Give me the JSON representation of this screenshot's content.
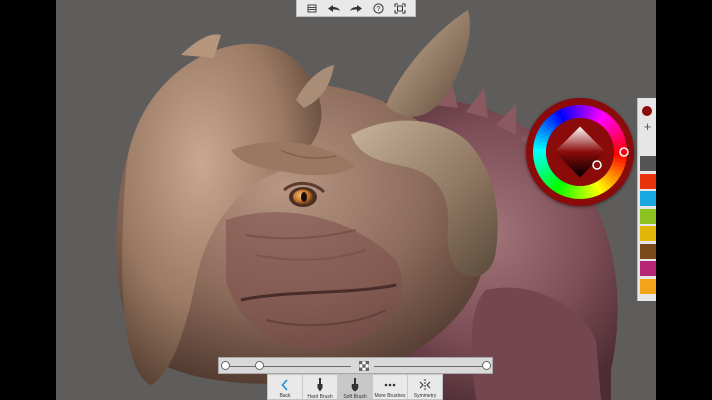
{
  "app": {
    "accent": "#8b0a0a",
    "canvas_bg": "#5f5d5c"
  },
  "top_toolbar": {
    "items": [
      {
        "icon": "layers-icon"
      },
      {
        "icon": "undo-icon"
      },
      {
        "icon": "redo-icon"
      },
      {
        "icon": "help-icon"
      },
      {
        "icon": "fullscreen-icon"
      }
    ]
  },
  "color_picker": {
    "current_color": "#8b0a0a",
    "add_label": "+"
  },
  "swatches": [
    "#555555",
    "#e8320a",
    "#18a7e0",
    "#8cc21f",
    "#e3b60c",
    "#7b4a1c",
    "#b52775",
    "#f3a51a"
  ],
  "sliders": {
    "size": 0.27,
    "opacity": 1.0
  },
  "bottom_toolbar": {
    "back_label": "Back",
    "hard_brush_label": "Hard Brush",
    "soft_brush_label": "Soft Brush",
    "more_brushes_label": "More Brushes",
    "symmetry_label": "Symmetry"
  }
}
